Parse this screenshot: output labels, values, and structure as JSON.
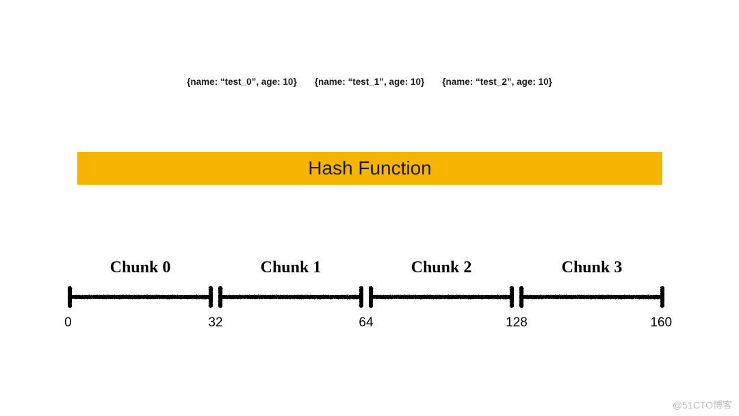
{
  "data_items": [
    "{name: “test_0”, age: 10}",
    "{name: “test_1”, age: 10}",
    "{name: “test_2”, age: 10}"
  ],
  "hash_bar": {
    "label": "Hash Function",
    "color": "#f5b400"
  },
  "chunks": {
    "labels": [
      "Chunk 0",
      "Chunk 1",
      "Chunk 2",
      "Chunk 3"
    ],
    "ticks": [
      "0",
      "32",
      "64",
      "128",
      "160"
    ]
  },
  "watermark": "@51CTO博客"
}
